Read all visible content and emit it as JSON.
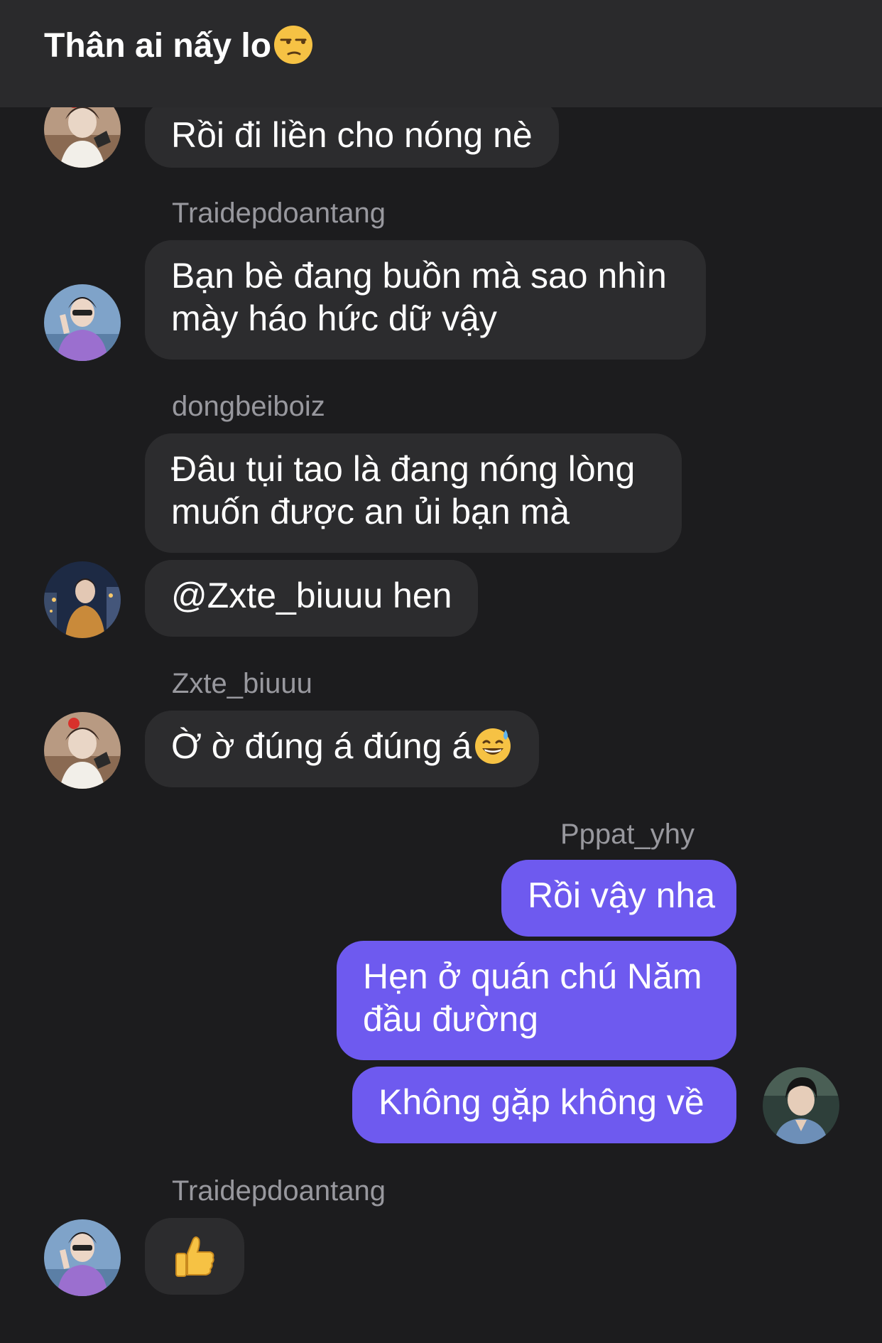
{
  "conversation": {
    "title": "Thân ai nấy lo",
    "title_emoji_icon": "unamused-face-icon"
  },
  "messages": [
    {
      "sender": "",
      "text": "Rồi đi liền cho nóng nè",
      "avatar_icon": "avatar-red-ball-icon"
    },
    {
      "sender": "Traidepdoantang",
      "lines": [
        "Bạn bè đang buồn mà sao nhìn",
        "mày háo hức dữ vậy"
      ],
      "avatar_icon": "avatar-purple-shirt-icon"
    },
    {
      "sender": "dongbeiboiz",
      "lines": [
        "Đâu tụi tao là đang nóng lòng",
        "muốn được an ủi bạn mà"
      ],
      "text2": "@Zxte_biuuu hen",
      "avatar_icon": "avatar-city-night-icon"
    },
    {
      "sender": "Zxte_biuuu",
      "text": "Ờ ờ đúng á đúng á",
      "emoji_icon": "grinning-sweat-icon",
      "avatar_icon": "avatar-red-ball-icon"
    },
    {
      "sender": "Pppat_yhy",
      "texts": [
        "Rồi vậy nha"
      ],
      "lines": [
        "Hẹn ở quán chú Năm",
        "đầu đường"
      ],
      "text3": "Không gặp không về",
      "avatar_icon": "avatar-denim-shirt-icon"
    },
    {
      "sender": "Traidepdoantang",
      "emoji_icon": "thumbs-up-icon",
      "avatar_icon": "avatar-purple-shirt-icon"
    }
  ],
  "colors": {
    "background": "#1c1c1e",
    "header": "#2a2a2c",
    "incoming_bubble": "#2c2c2e",
    "outgoing_bubble": "#6e5aef",
    "sender_name": "#98989e"
  }
}
